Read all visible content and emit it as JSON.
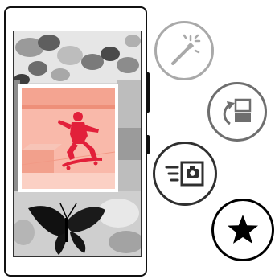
{
  "device": {
    "screen": {
      "photos": [
        "collage-background",
        "skateboarder-photo",
        "butterfly-photo"
      ]
    }
  },
  "actions": [
    {
      "icon": "magic-wand-icon"
    },
    {
      "icon": "rotate-icon"
    },
    {
      "icon": "share-photo-icon"
    },
    {
      "icon": "star-icon"
    }
  ],
  "colors": {
    "highlight_photo_bg": "#f9b9aa",
    "skater": "#e2203a",
    "ring_light": "#a9a9a9",
    "ring_mid": "#6e6e6e",
    "ring_dark": "#2f2f2f",
    "ring_black": "#000000"
  }
}
